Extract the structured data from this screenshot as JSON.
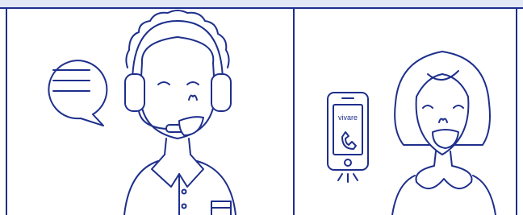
{
  "phone": {
    "brand_label": "vivare"
  },
  "colors": {
    "line": "#1e2f8c",
    "background": "#ffffff",
    "top_band": "#e3e8f6"
  },
  "icons": {
    "speech_bubble": "speech-bubble-icon",
    "handset": "phone-handset-icon",
    "ringing": "ringing-lines-icon"
  }
}
